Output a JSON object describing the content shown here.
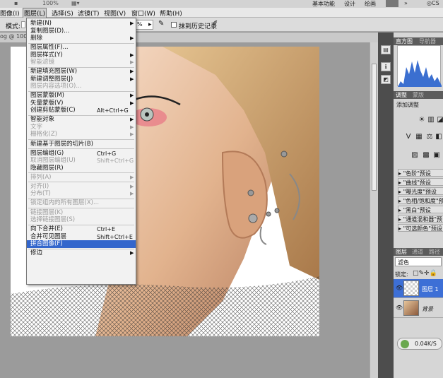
{
  "topbar": {
    "zoom_dropdown": "100%",
    "workspaces": [
      "基本功能",
      "设计",
      "绘画"
    ]
  },
  "menubar": {
    "items": [
      "图像(I)",
      "图层(L)",
      "选择(S)",
      "滤镜(T)",
      "视图(V)",
      "窗口(W)",
      "帮助(H)"
    ],
    "active_index": 1
  },
  "options_bar": {
    "mode_label": "模式:",
    "zoom_value": "%",
    "erase_history_label": "抹到历史记录"
  },
  "document": {
    "tab_label": "og @ 100"
  },
  "layer_menu": {
    "items": [
      {
        "label": "新建(N)",
        "arrow": true
      },
      {
        "label": "复制图层(D)..."
      },
      {
        "label": "删除",
        "arrow": true,
        "sep_after": true
      },
      {
        "label": "图层属性(F)..."
      },
      {
        "label": "图层样式(Y)",
        "arrow": true
      },
      {
        "label": "智能滤镜",
        "arrow": true,
        "disabled": true,
        "sep_after": true
      },
      {
        "label": "新建填充图层(W)",
        "arrow": true
      },
      {
        "label": "新建调整图层(J)",
        "arrow": true
      },
      {
        "label": "图层内容选项(O)...",
        "disabled": true,
        "sep_after": true
      },
      {
        "label": "图层蒙版(M)",
        "arrow": true
      },
      {
        "label": "矢量蒙版(V)",
        "arrow": true
      },
      {
        "label": "创建剪贴蒙版(C)",
        "shortcut": "Alt+Ctrl+G",
        "sep_after": true
      },
      {
        "label": "智能对象",
        "arrow": true
      },
      {
        "label": "文字",
        "arrow": true,
        "disabled": true
      },
      {
        "label": "栅格化(Z)",
        "arrow": true,
        "disabled": true,
        "sep_after": true
      },
      {
        "label": "新建基于图层的切片(B)",
        "sep_after": true
      },
      {
        "label": "图层编组(G)",
        "shortcut": "Ctrl+G"
      },
      {
        "label": "取消图层编组(U)",
        "shortcut": "Shift+Ctrl+G",
        "disabled": true
      },
      {
        "label": "隐藏图层(R)",
        "sep_after": true
      },
      {
        "label": "排列(A)",
        "arrow": true,
        "disabled": true,
        "sep_after": true
      },
      {
        "label": "对齐(I)",
        "arrow": true,
        "disabled": true
      },
      {
        "label": "分布(T)",
        "arrow": true,
        "disabled": true,
        "sep_after": true
      },
      {
        "label": "锁定组内的所有图层(X)...",
        "disabled": true,
        "sep_after": true
      },
      {
        "label": "链接图层(K)",
        "disabled": true
      },
      {
        "label": "选择链接图层(S)",
        "disabled": true,
        "sep_after": true
      },
      {
        "label": "向下合并(E)",
        "shortcut": "Ctrl+E"
      },
      {
        "label": "合并可见图层",
        "shortcut": "Shift+Ctrl+E"
      },
      {
        "label": "拼合图像(F)",
        "selected": true,
        "sep_after": true
      },
      {
        "label": "修边",
        "arrow": true
      }
    ]
  },
  "panels": {
    "histogram_tabs": [
      "直方图",
      "导航器"
    ],
    "adjust_tabs": [
      "调整",
      "蒙版"
    ],
    "add_adjust_label": "添加调整",
    "presets": [
      "\"色阶\"预设",
      "\"曲线\"预设",
      "\"曝光度\"预设",
      "\"色相/饱和度\"预",
      "\"黑白\"预设",
      "\"通道混和器\"预",
      "\"可选颜色\"预设"
    ],
    "layer_tabs": [
      "图层",
      "通道",
      "路径"
    ],
    "blend_mode": "滤色",
    "lock_label": "锁定:",
    "layers": [
      {
        "name": "图层 1",
        "selected": true
      },
      {
        "name": "背景",
        "selected": false
      }
    ],
    "net_speed": "0.04K/S"
  },
  "colors": {
    "menu_highlight": "#3366cc",
    "layer_selected": "#3d6fd6"
  }
}
